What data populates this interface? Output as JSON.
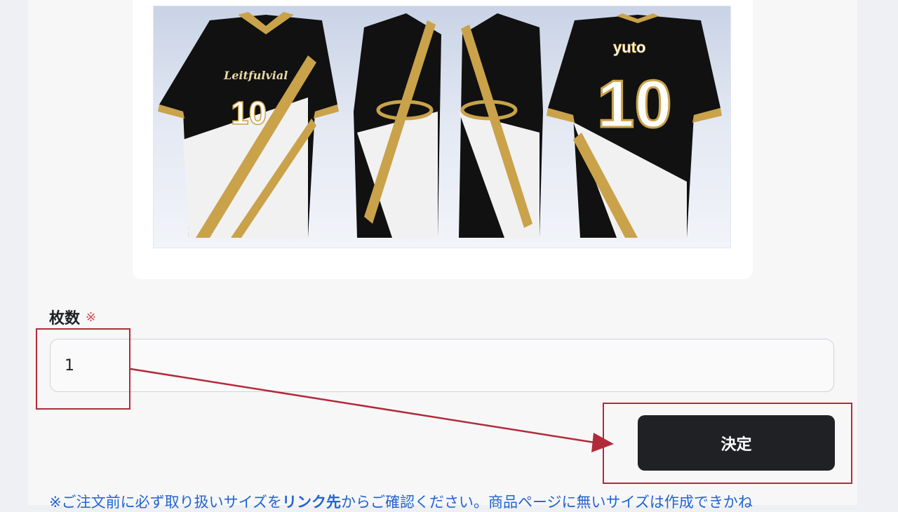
{
  "product_image": {
    "front_text": "Leitfulvial",
    "front_number": "10",
    "back_name": "yuto",
    "back_number": "10"
  },
  "quantity": {
    "label": "枚数",
    "required_mark": "※",
    "value": "1"
  },
  "submit": {
    "label": "決定"
  },
  "notice": {
    "prefix": "※ご注文前に必ず取り扱いサイズを",
    "link": "リンク先",
    "suffix": "からご確認ください。商品ページに無いサイズは作成できかね"
  },
  "colors": {
    "annotation": "#b22a3a",
    "button_bg": "#1f2125",
    "jersey_black": "#111111",
    "jersey_gold": "#c9a24a",
    "link_blue": "#2264d1"
  }
}
